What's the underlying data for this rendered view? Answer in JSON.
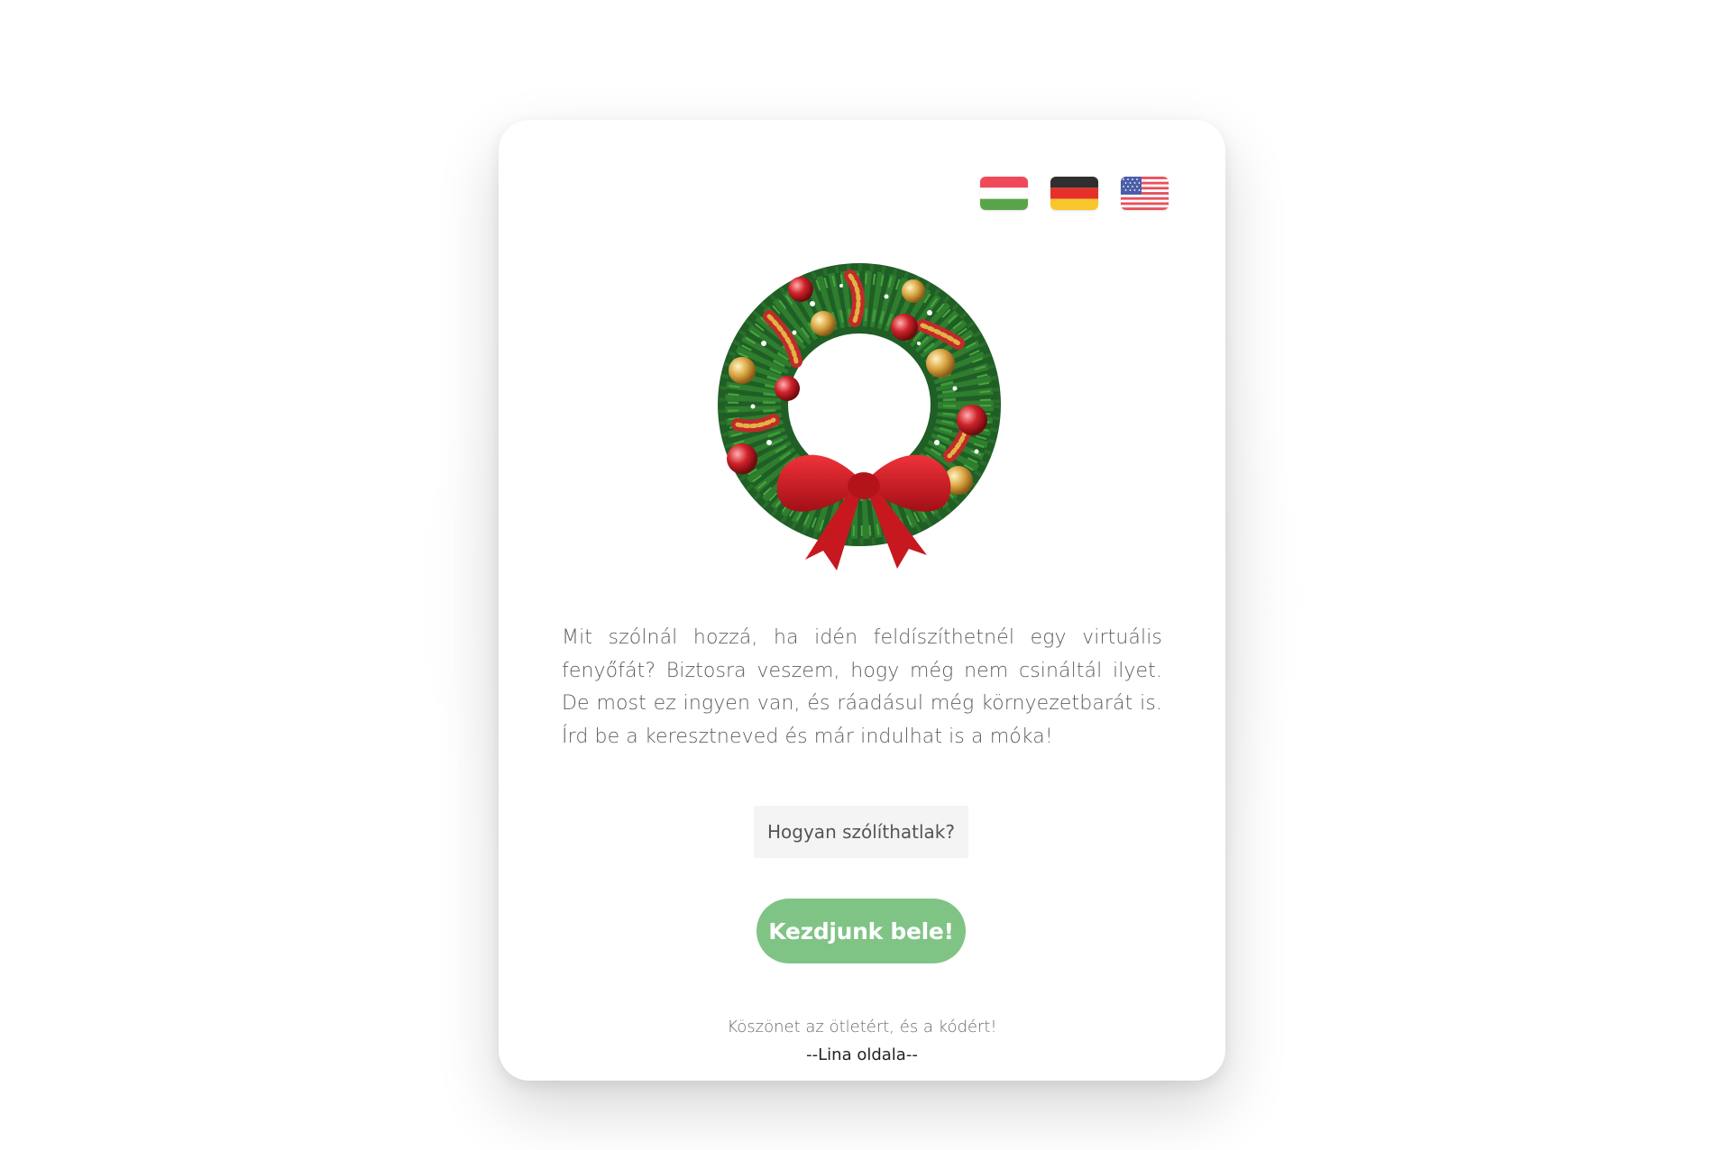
{
  "languages": [
    {
      "code": "hu",
      "icon": "hungary-flag-icon"
    },
    {
      "code": "de",
      "icon": "germany-flag-icon"
    },
    {
      "code": "en",
      "icon": "usa-flag-icon"
    }
  ],
  "hero": {
    "icon": "christmas-wreath-icon"
  },
  "intro_text": "Mit szólnál hozzá, ha idén feldíszíthetnél egy virtuális fenyőfát? Biztosra veszem, hogy még nem csináltál ilyet. De most ez ingyen van, és ráadásul még környezetbarát is. Írd be a keresztneved és már indulhat is a móka!",
  "name_field": {
    "placeholder": "Hogyan szólíthatlak?",
    "value": ""
  },
  "start_button": {
    "label": "Kezdjunk bele!"
  },
  "footer": {
    "thanks": "Köszönet az ötletért, és a kódért!",
    "credit": "--Lina oldala--"
  },
  "colors": {
    "button": "#7fc485",
    "card": "#ffffff",
    "input_bg": "#f4f4f4",
    "text": "#5f5f5f"
  }
}
